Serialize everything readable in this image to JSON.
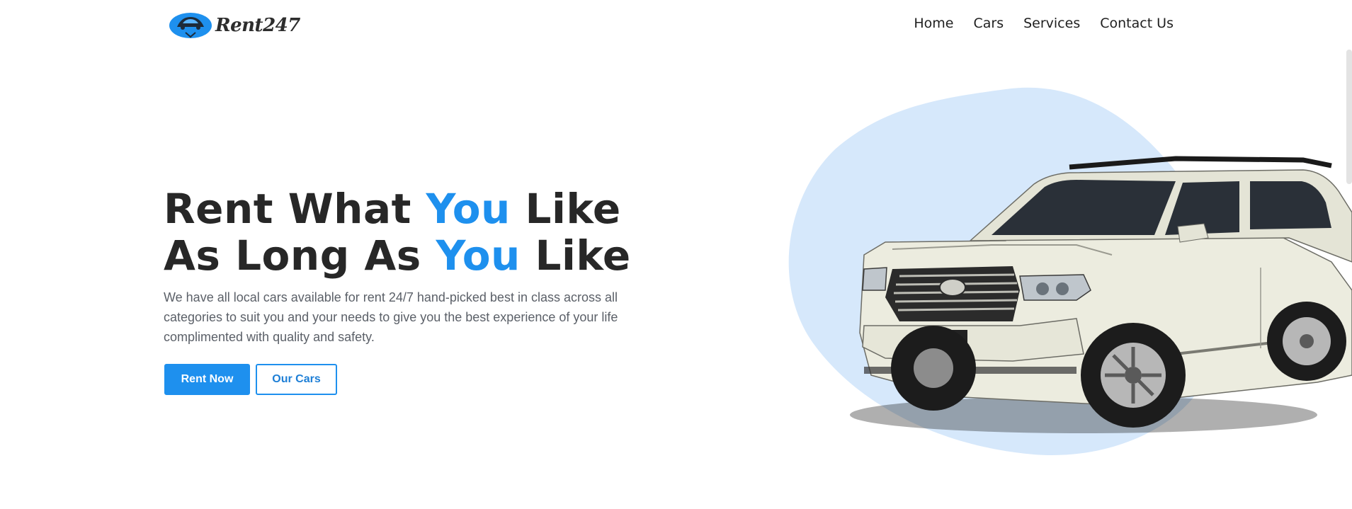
{
  "brand": {
    "name": "Rent247"
  },
  "nav": {
    "items": [
      {
        "label": "Home"
      },
      {
        "label": "Cars"
      },
      {
        "label": "Services"
      },
      {
        "label": "Contact Us"
      }
    ]
  },
  "hero": {
    "line1_a": "Rent What ",
    "line1_accent": "You",
    "line1_b": " Like",
    "line2_a": "As Long As ",
    "line2_accent": "You",
    "line2_b": " Like",
    "description": "We have all local cars available for rent 24/7 hand-picked best in class across all categories to suit you and your needs to give you the best experience of your life complimented with quality and safety.",
    "primary_button": "Rent Now",
    "secondary_button": "Our Cars"
  },
  "colors": {
    "accent": "#1e90ee",
    "blob": "#d6e8fb",
    "car_body": "#ececdf",
    "text_dark": "#272727"
  },
  "icons": {
    "logo": "car-logo-icon"
  }
}
